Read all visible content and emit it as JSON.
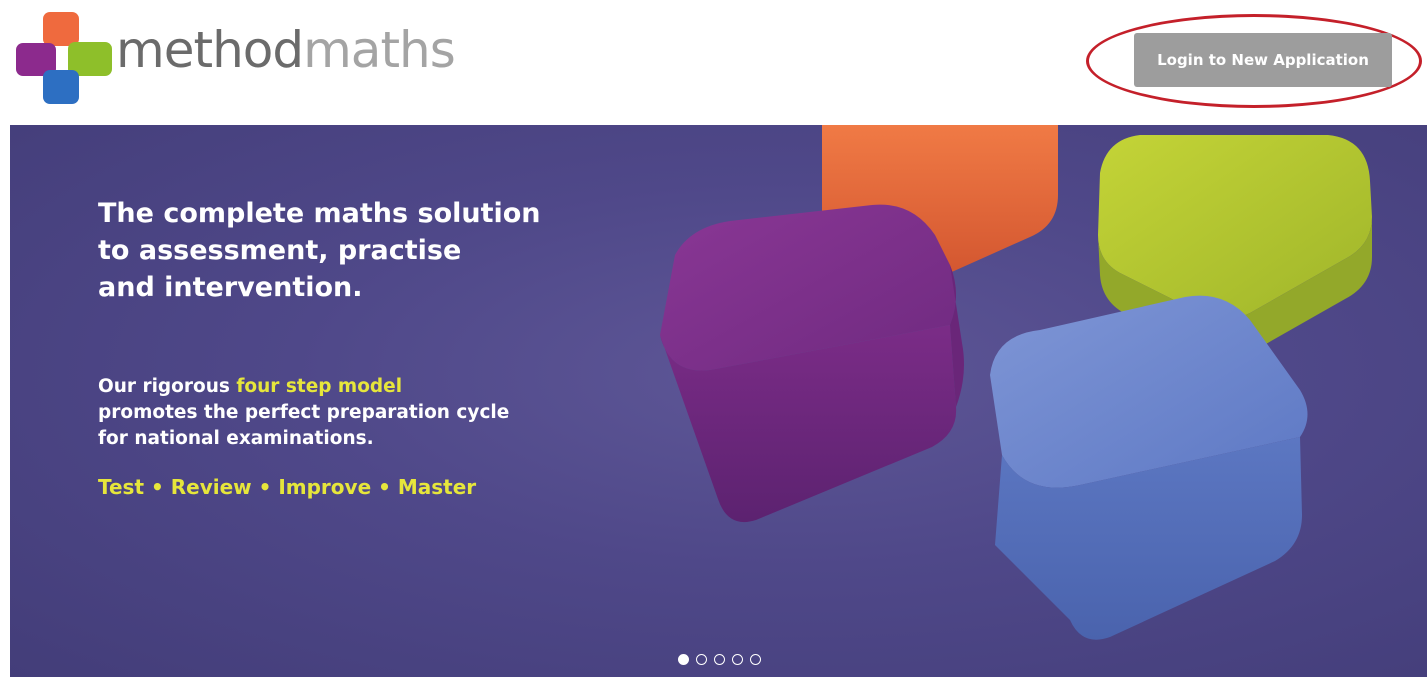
{
  "header": {
    "logo": {
      "word1": "method",
      "word2": "maths"
    },
    "login_label": "Login to New Application"
  },
  "hero": {
    "headline": [
      "The complete maths solution",
      "to assessment, practise",
      "and intervention."
    ],
    "body_prefix": "Our rigorous ",
    "body_highlight": "four step model",
    "body_lines": [
      "promotes the perfect preparation cycle",
      "for national examinations."
    ],
    "steps": "Test • Review • Improve • Master"
  },
  "carousel": {
    "slides": 5,
    "active_index": 0
  },
  "colors": {
    "brand_orange": "#ef6a3e",
    "brand_purple": "#8c2a8d",
    "brand_green": "#8ebf2a",
    "brand_blue": "#2d6fc2",
    "hero_bg": "#4f4889",
    "accent_yellow": "#e6e63b",
    "button_grey": "#9d9d9d",
    "highlight_ring": "#c4202a"
  },
  "icons": [
    "methodmaths-logo-icon"
  ]
}
